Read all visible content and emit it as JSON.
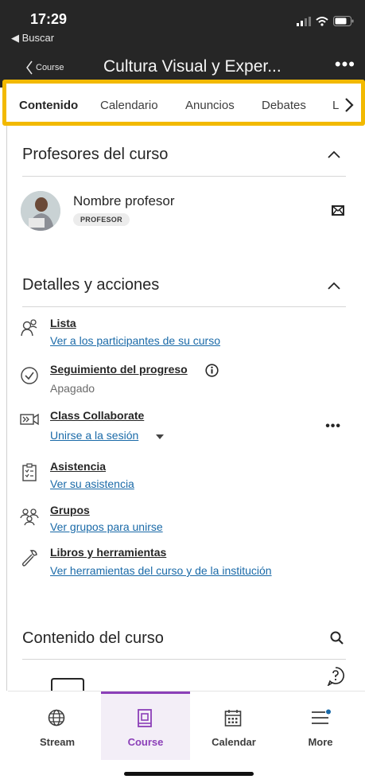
{
  "status_bar": {
    "time": "17:29",
    "back_label": "◀ Buscar"
  },
  "nav": {
    "back_label": "Course",
    "title": "Cultura Visual y Exper...",
    "more": "•••"
  },
  "tabs": [
    {
      "label": "Contenido",
      "active": true
    },
    {
      "label": "Calendario",
      "active": false
    },
    {
      "label": "Anuncios",
      "active": false
    },
    {
      "label": "Debates",
      "active": false
    },
    {
      "label": "L",
      "active": false
    }
  ],
  "instructors": {
    "title": "Profesores del curso",
    "name": "Nombre profesor",
    "badge": "PROFESOR"
  },
  "details": {
    "title": "Detalles y acciones",
    "items": [
      {
        "icon": "roster-icon",
        "title": "Lista",
        "link": "Ver a los participantes de su curso"
      },
      {
        "icon": "progress-check-icon",
        "title": "Seguimiento del progreso",
        "subtitle": "Apagado"
      },
      {
        "icon": "collaborate-icon",
        "title": "Class Collaborate",
        "link": "Unirse a la sesión"
      },
      {
        "icon": "attendance-icon",
        "title": "Asistencia",
        "link": "Ver su asistencia"
      },
      {
        "icon": "groups-icon",
        "title": "Grupos",
        "link": "Ver grupos para unirse"
      },
      {
        "icon": "wrench-icon",
        "title": "Libros y herramientas",
        "link": "Ver herramientas del curso y de la institución"
      }
    ]
  },
  "content": {
    "title": "Contenido del curso"
  },
  "bottom_nav": [
    {
      "label": "Stream",
      "active": false
    },
    {
      "label": "Course",
      "active": true
    },
    {
      "label": "Calendar",
      "active": false
    },
    {
      "label": "More",
      "active": false
    }
  ],
  "colors": {
    "accent": "#8b3fb8",
    "link": "#1a6aa8",
    "highlight": "#f2b900",
    "header": "#262626"
  }
}
